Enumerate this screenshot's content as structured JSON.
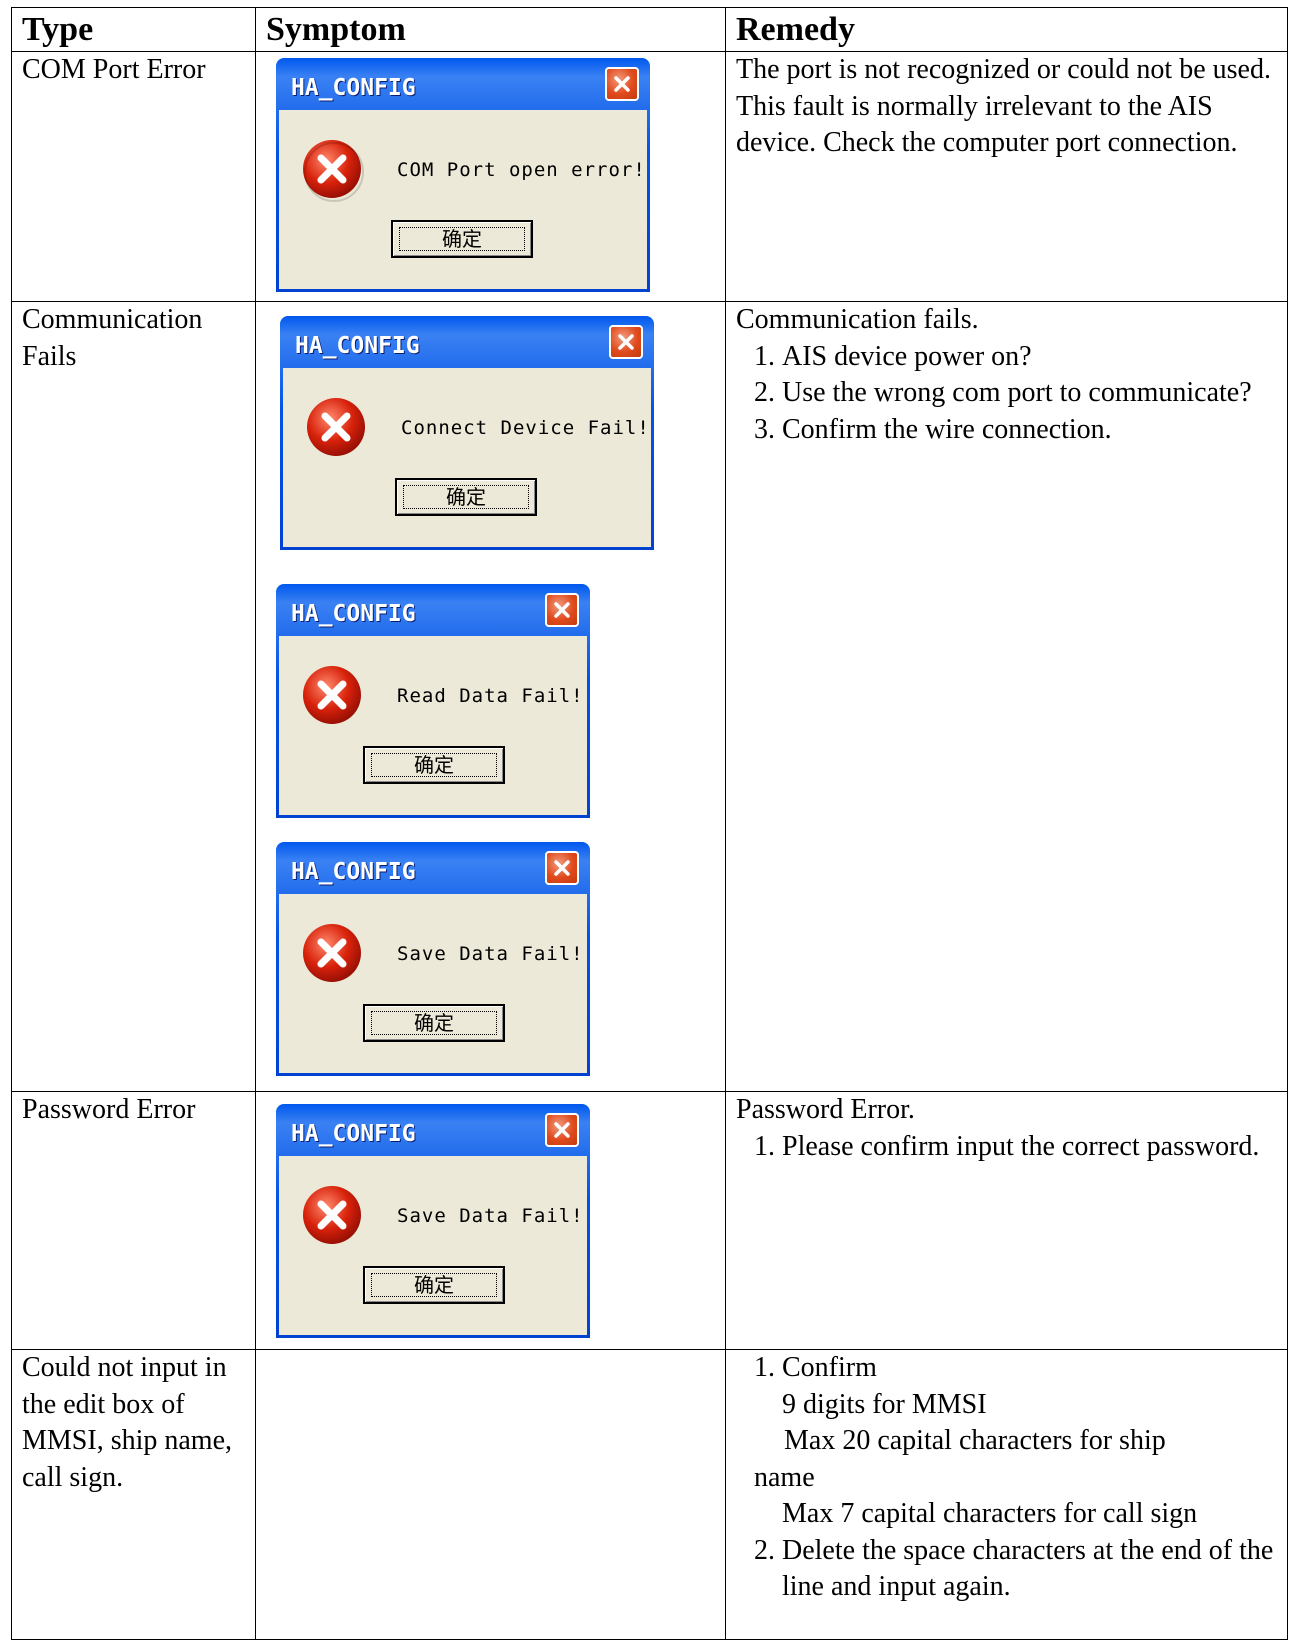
{
  "table": {
    "headers": [
      "Type",
      "Symptom",
      "Remedy"
    ],
    "rows": [
      {
        "type": "COM Port Error",
        "dialogs": [
          {
            "title": "HA_CONFIG",
            "message": "COM Port open error!",
            "button": "确定"
          }
        ],
        "remedy_intro": "The port is not recognized or could not be used. This fault is normally irrelevant to the AIS device. Check the computer port connection."
      },
      {
        "type": "Communication Fails",
        "dialogs": [
          {
            "title": "HA_CONFIG",
            "message": "Connect Device Fail!",
            "button": "确定"
          },
          {
            "title": "HA_CONFIG",
            "message": "Read Data Fail!",
            "button": "确定"
          },
          {
            "title": "HA_CONFIG",
            "message": "Save Data Fail!",
            "button": "确定"
          }
        ],
        "remedy_intro": "Communication fails.",
        "remedy_items": [
          "AIS device power on?",
          "Use the wrong com port to communicate?",
          "Confirm the wire connection."
        ]
      },
      {
        "type": "Password Error",
        "dialogs": [
          {
            "title": "HA_CONFIG",
            "message": "Save Data Fail!",
            "button": "确定"
          }
        ],
        "remedy_intro": "Password Error.",
        "remedy_items": [
          "Please confirm input the correct password."
        ]
      },
      {
        "type": "Could not input in the edit box of MMSI, ship name, call sign.",
        "remedy_item1": "Confirm",
        "remedy_sub1": "9    digits for MMSI",
        "remedy_sub2": "Max 20 capital characters for ship",
        "remedy_sub2b": "name",
        "remedy_sub3": "Max 7 capital characters for call sign",
        "remedy_item2": "Delete the space characters at the end of the line and input again."
      }
    ]
  },
  "colors": {
    "dialog_face": "#ece9d8",
    "titlebar": "#0453e4",
    "close": "#e04a1c",
    "error_icon": "#d8220b"
  },
  "icons": {
    "close": "close-x-icon",
    "error": "error-circle-x-icon"
  }
}
